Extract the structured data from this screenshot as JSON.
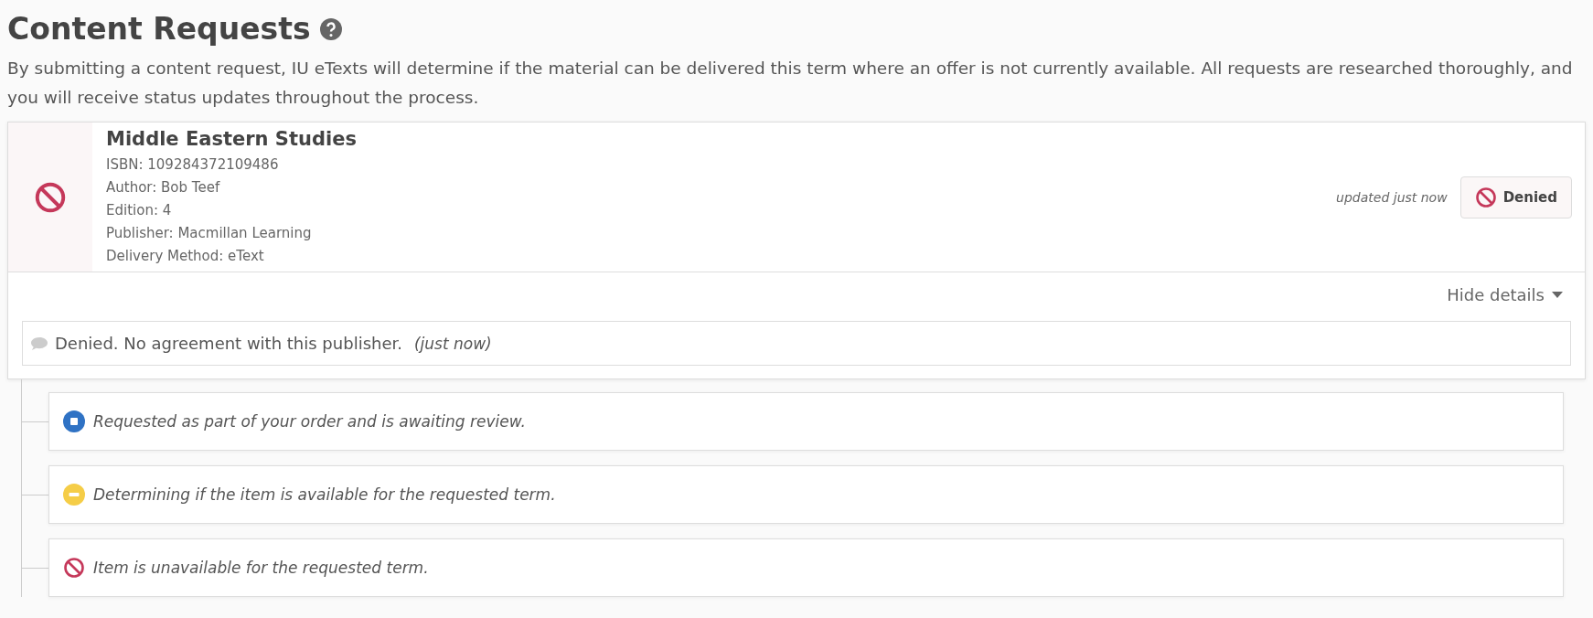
{
  "header": {
    "title": "Content Requests",
    "description": "By submitting a content request, IU eTexts will determine if the material can be delivered this term where an offer is not currently available. All requests are researched thoroughly, and you will receive status updates throughout the process."
  },
  "request": {
    "kind": "denied",
    "title": "Middle Eastern Studies",
    "details": [
      "ISBN: 109284372109486",
      "Author: Bob Teef",
      "Edition: 4",
      "Publisher: Macmillan Learning",
      "Delivery Method: eText"
    ],
    "updated": "updated just now",
    "status_label": "Denied",
    "toggle": "Hide details",
    "expanded": true,
    "comment": {
      "text": "Denied. No agreement with this publisher.",
      "time": "(just now)"
    }
  },
  "history": [
    {
      "kind": "submitted",
      "text": "Requested as part of your order and is awaiting review."
    },
    {
      "kind": "review",
      "text": "Determining if the item is available for the requested term."
    },
    {
      "kind": "denied",
      "text": "Item is unavailable for the requested term."
    }
  ]
}
